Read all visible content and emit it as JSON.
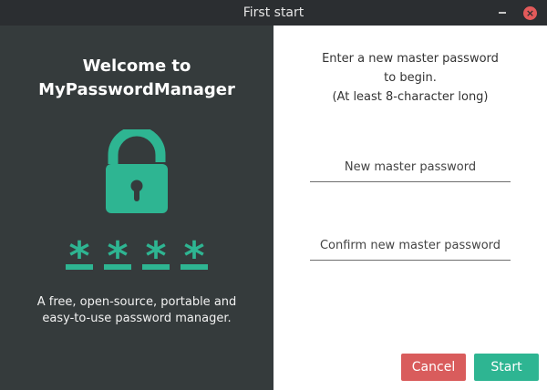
{
  "window": {
    "title": "First start",
    "close_glyph": "×"
  },
  "left_panel": {
    "welcome_line1": "Welcome to",
    "welcome_line2": "MyPasswordManager",
    "tagline_line1": "A free, open-source, portable and",
    "tagline_line2": "easy-to-use password manager.",
    "illustration_icon": "unlocked-padlock-icon",
    "asterisk_glyph": "*",
    "accent_color": "#2eb592"
  },
  "right_panel": {
    "instruction_line1": "Enter a new master password",
    "instruction_line2": "to begin.",
    "instruction_line3": "(At least 8-character long)",
    "new_password_placeholder": "New master password",
    "confirm_password_placeholder": "Confirm new master password"
  },
  "buttons": {
    "cancel_label": "Cancel",
    "start_label": "Start",
    "cancel_color": "#d95c5c",
    "start_color": "#2eb592"
  }
}
